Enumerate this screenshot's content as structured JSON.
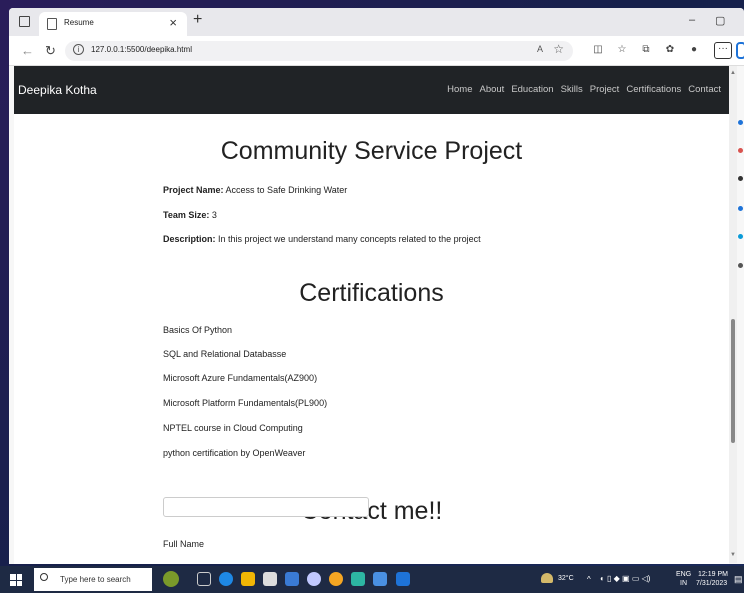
{
  "browser": {
    "tab_title": "Resume",
    "tab_close": "×",
    "new_tab": "+",
    "url": "127.0.0.1:5500/deepika.html",
    "minimize": "–",
    "maximize": "▢",
    "menu": "···"
  },
  "site": {
    "brand": "Deepika Kotha",
    "nav": [
      "Home",
      "About",
      "Education",
      "Skills",
      "Project",
      "Certifications",
      "Contact"
    ]
  },
  "project": {
    "heading": "Community Service Project",
    "name_label": "Project Name:",
    "name_value": "Access to Safe Drinking Water",
    "team_label": "Team Size:",
    "team_value": "3",
    "desc_label": "Description:",
    "desc_value": "In this project we understand many concepts related to the project"
  },
  "certifications": {
    "heading": "Certifications",
    "items": [
      "Basics Of Python",
      "SQL and Relational Databasse",
      "Microsoft Azure Fundamentals(AZ900)",
      "Microsoft Platform Fundamentals(PL900)",
      "NPTEL course in Cloud Computing",
      "python certification by OpenWeaver"
    ]
  },
  "contact": {
    "heading": "Contact me!!",
    "full_name_label": "Full Name"
  },
  "taskbar": {
    "search_placeholder": "Type here to search",
    "temperature": "32°C",
    "lang_1": "ENG",
    "lang_2": "IN",
    "time": "12:19 PM",
    "date": "7/31/2023"
  },
  "colors": {
    "navbar": "#202326",
    "taskbar": "#1e2a44",
    "accent": "#1e73d8"
  }
}
